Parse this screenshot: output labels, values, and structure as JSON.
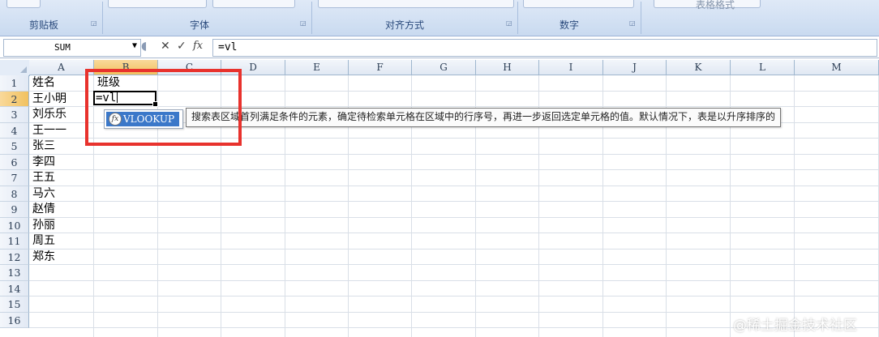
{
  "ribbon": {
    "groups": [
      {
        "label": "剪贴板"
      },
      {
        "label": "字体"
      },
      {
        "label": "对齐方式"
      },
      {
        "label": "数字"
      },
      {
        "label": "表格格式"
      }
    ]
  },
  "formula_bar": {
    "name_box": "SUM",
    "cancel_glyph": "✕",
    "enter_glyph": "✓",
    "fx_glyph": "fx",
    "formula": "=vl"
  },
  "sheet": {
    "columns": [
      "A",
      "B",
      "C",
      "D",
      "E",
      "F",
      "G",
      "H",
      "I",
      "J",
      "K",
      "L",
      "M"
    ],
    "rows": [
      "1",
      "2",
      "3",
      "4",
      "5",
      "6",
      "7",
      "8",
      "9",
      "10",
      "11",
      "12",
      "13",
      "14",
      "15",
      "16"
    ],
    "cells": {
      "A1": "姓名",
      "B1": "班级",
      "A2": "王小明",
      "A3": "刘乐乐",
      "A4": "王一一",
      "A5": "张三",
      "A6": "李四",
      "A7": "王五",
      "A8": "马六",
      "A9": "赵倩",
      "A10": "孙丽",
      "A11": "周五",
      "A12": "郑东"
    },
    "active_cell_value": "=vl"
  },
  "autocomplete": {
    "item": "VLOOKUP",
    "icon_glyph": "fx",
    "tooltip": "搜索表区域首列满足条件的元素，确定待检索单元格在区域中的行序号，再进一步返回选定单元格的值。默认情况下，表是以升序排序的"
  },
  "watermark": "@稀土掘金技术社区",
  "colors": {
    "highlight": "#e8322d",
    "selection": "#3b78c9",
    "header_selected": "#f1c15f"
  }
}
